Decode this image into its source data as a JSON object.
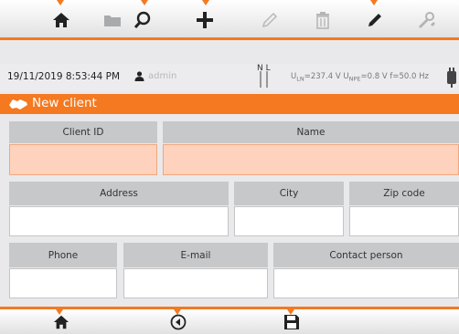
{
  "top_toolbar": {
    "buttons": [
      {
        "icon": "home-icon"
      },
      {
        "icon": "folder-icon"
      },
      {
        "icon": "search-icon"
      },
      {
        "icon": "plus-icon"
      },
      {
        "icon": "pencil-icon"
      },
      {
        "icon": "trash-icon"
      },
      {
        "icon": "marker-icon"
      },
      {
        "icon": "tools-icon"
      }
    ]
  },
  "status_bar": {
    "datetime": "19/11/2019 8:53:44 PM",
    "user": "admin",
    "nl_label": "N L",
    "u_ln_label": "U",
    "u_ln_sub": "LN",
    "u_ln_value": "=237.4 V",
    "u_npe_label": "U",
    "u_npe_sub": "NPE",
    "u_npe_value": "=0.8 V",
    "freq": "f=50.0 Hz"
  },
  "title": "New client",
  "form": {
    "client_id": {
      "label": "Client ID",
      "value": ""
    },
    "name": {
      "label": "Name",
      "value": ""
    },
    "address": {
      "label": "Address",
      "value": ""
    },
    "city": {
      "label": "City",
      "value": ""
    },
    "zip": {
      "label": "Zip code",
      "value": ""
    },
    "phone": {
      "label": "Phone",
      "value": ""
    },
    "email": {
      "label": "E-mail",
      "value": ""
    },
    "contact": {
      "label": "Contact person",
      "value": ""
    }
  },
  "bottom_toolbar": {
    "buttons": [
      {
        "icon": "home-icon"
      },
      {
        "icon": "back-icon"
      },
      {
        "icon": "save-icon"
      }
    ]
  },
  "colors": {
    "accent": "#f47920",
    "highlight_field": "#fed2bd",
    "header_cell": "#c6c8ca"
  }
}
